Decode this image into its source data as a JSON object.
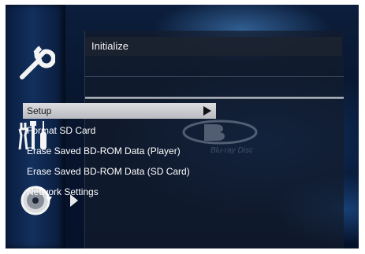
{
  "panel": {
    "title": "Initialize"
  },
  "menu": {
    "items": [
      {
        "label": "Setup",
        "selected": true
      },
      {
        "label": "Format SD Card",
        "selected": false
      },
      {
        "label": "Erase Saved BD-ROM Data (Player)",
        "selected": false
      },
      {
        "label": "Erase Saved BD-ROM Data (SD Card)",
        "selected": false
      },
      {
        "label": "Network Settings",
        "selected": false
      }
    ]
  },
  "sidebar": {
    "items": [
      {
        "icon": "wrench-icon"
      },
      {
        "icon": "tools-icon"
      },
      {
        "icon": "disc-reset-icon"
      }
    ]
  },
  "watermark": {
    "logo_icon": "blu-ray-disc-logo",
    "text": "Blu-ray Disc"
  },
  "colors": {
    "background": "#0a1a36",
    "selection": "#c9cbd0",
    "text": "#ffffff"
  }
}
